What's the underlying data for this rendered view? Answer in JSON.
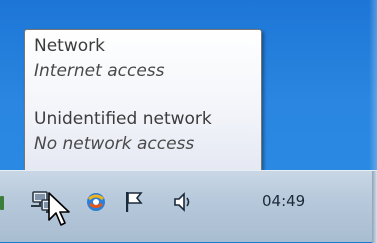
{
  "tooltip": {
    "connections": [
      {
        "title": "Network",
        "status": "Internet access"
      },
      {
        "title": "Unidentified network",
        "status": "No network access"
      }
    ]
  },
  "tray": {
    "icons": [
      "network-icon",
      "update-icon",
      "action-center-flag-icon",
      "volume-icon"
    ],
    "clock": "04:49"
  },
  "colors": {
    "desktop": "#2a86e0",
    "taskbar": "#b7c9db",
    "tooltip_border": "#767676",
    "text": "#4c4c4c"
  }
}
